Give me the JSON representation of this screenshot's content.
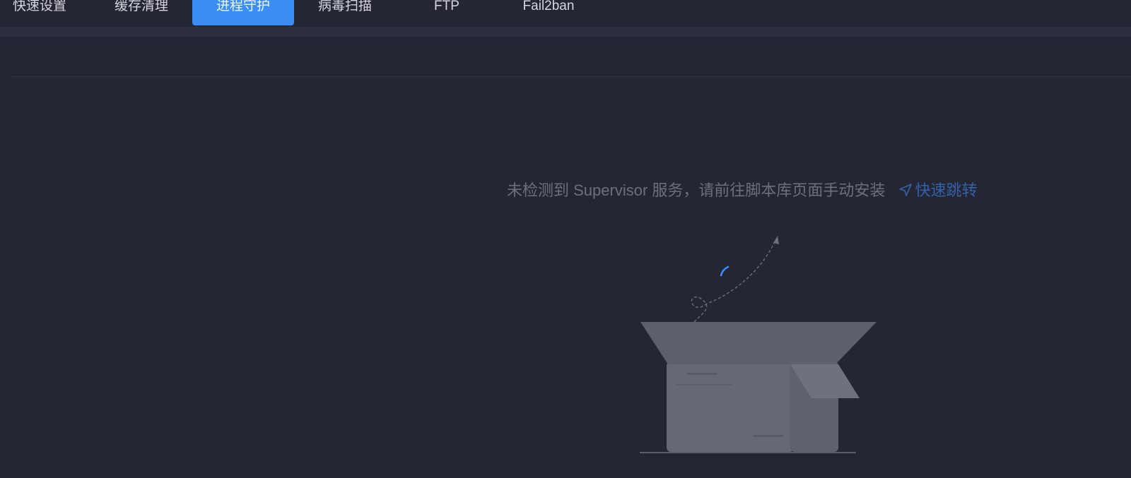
{
  "tabs": [
    {
      "label": "快速设置",
      "active": false
    },
    {
      "label": "缓存清理",
      "active": false
    },
    {
      "label": "进程守护",
      "active": true
    },
    {
      "label": "病毒扫描",
      "active": false
    },
    {
      "label": "FTP",
      "active": false
    },
    {
      "label": "Fail2ban",
      "active": false
    }
  ],
  "notice": {
    "message": "未检测到 Supervisor 服务，请前往脚本库页面手动安装",
    "link_label": "快速跳转",
    "link_icon": "navigation-arrow-icon"
  },
  "colors": {
    "background": "#242634",
    "active_tab": "#3a8ef6",
    "link": "#3462a8",
    "muted_text": "#6c6f7c"
  }
}
